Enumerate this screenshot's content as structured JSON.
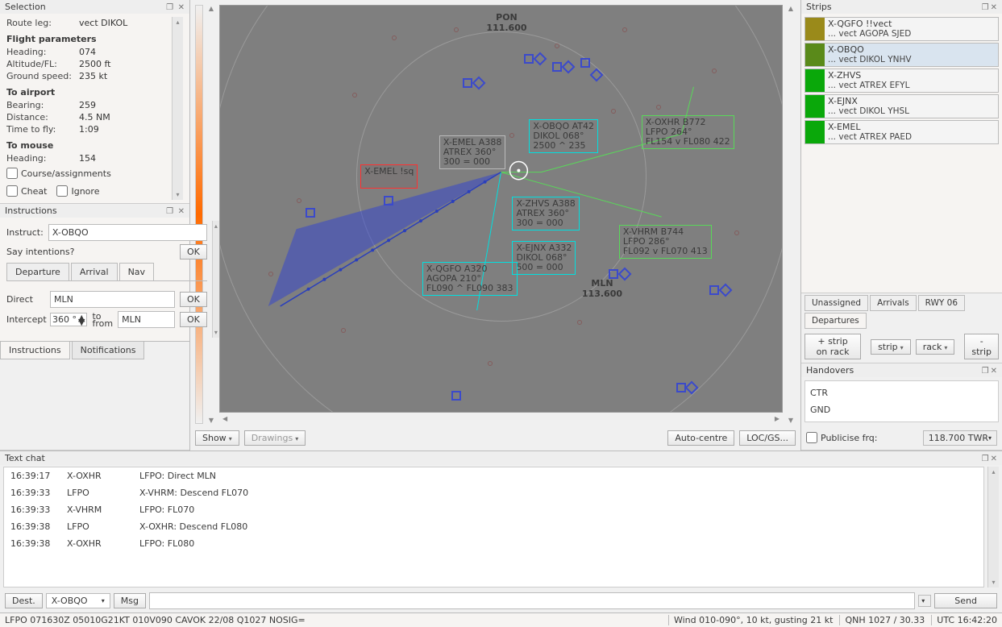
{
  "selection": {
    "title": "Selection",
    "route_leg_label": "Route leg:",
    "route_leg_value": "vect DIKOL",
    "flight_params_title": "Flight parameters",
    "heading_label": "Heading:",
    "heading_value": "074",
    "altitude_label": "Altitude/FL:",
    "altitude_value": "2500 ft",
    "gs_label": "Ground speed:",
    "gs_value": "235 kt",
    "to_airport_title": "To airport",
    "bearing_label": "Bearing:",
    "bearing_value": "259",
    "distance_label": "Distance:",
    "distance_value": "4.5 NM",
    "ttf_label": "Time to fly:",
    "ttf_value": "1:09",
    "to_mouse_title": "To mouse",
    "mheading_label": "Heading:",
    "mheading_value": "154",
    "course_label": "Course/assignments",
    "cheat_label": "Cheat",
    "ignore_label": "Ignore"
  },
  "instructions": {
    "title": "Instructions",
    "instruct_label": "Instruct:",
    "instruct_value": "X-OBQO",
    "say_label": "Say intentions?",
    "ok": "OK",
    "tabs": [
      "Departure",
      "Arrival",
      "Nav"
    ],
    "active_tab": "Nav",
    "direct_label": "Direct",
    "direct_value": "MLN",
    "intercept_label": "Intercept",
    "intercept_deg": "360 °",
    "tofrom_label_to": "to",
    "tofrom_label_from": "from",
    "intercept_value": "MLN",
    "bottom_tabs": [
      "Instructions",
      "Notifications"
    ],
    "active_bottom_tab": "Notifications"
  },
  "radar": {
    "show_btn": "Show",
    "drawings_btn": "Drawings",
    "autocentre_btn": "Auto-centre",
    "locgs_btn": "LOC/GS...",
    "vor_pon": {
      "name": "PON",
      "freq": "111.600"
    },
    "vor_mln": {
      "name": "MLN",
      "freq": "113.600"
    },
    "blocks": {
      "obqo": [
        "X-OBQO   AT42",
        "DIKOL  068°",
        "2500 ^ 235"
      ],
      "emel": [
        "X-EMEL   A388",
        "ATREX  360°",
        "300 =  000"
      ],
      "zhvs": [
        "X-ZHVS   A388",
        "ATREX  360°",
        "300 =  000"
      ],
      "ejnx": [
        "X-EJNX   A332",
        "DIKOL  068°",
        "500 =  000"
      ],
      "qgfo": [
        "X-QGFO   A320",
        "AGOPA  210°",
        "FL090 ^ FL090  383"
      ],
      "oxhr": [
        "X-OXHR   B772",
        "LFPO  264°",
        "FL154 v FL080  422"
      ],
      "vhrm": [
        "X-VHRM   B744",
        "LFPO  286°",
        "FL092 v FL070  413"
      ],
      "red": [
        "X-EMEL  !sq",
        " ",
        " "
      ]
    }
  },
  "strips": {
    "title": "Strips",
    "items": [
      {
        "l1": "X-QGFO  !!vect",
        "l2": "... vect AGOPA  SJED",
        "color": "#9a8a1a"
      },
      {
        "l1": "X-OBQO",
        "l2": "... vect DIKOL  YNHV",
        "color": "#5a8a1a",
        "sel": true
      },
      {
        "l1": "X-ZHVS",
        "l2": "... vect ATREX  EFYL",
        "color": "#0aa80a"
      },
      {
        "l1": "X-EJNX",
        "l2": "... vect DIKOL  YHSL",
        "color": "#0aa80a"
      },
      {
        "l1": "X-EMEL",
        "l2": "... vect ATREX  PAED",
        "color": "#0aa80a"
      }
    ],
    "racks": [
      "Unassigned",
      "Arrivals",
      "RWY 06",
      "Departures"
    ],
    "active_rack": "Departures",
    "btn_addrack": "+ strip on rack",
    "btn_strip": "strip",
    "btn_rack": "rack",
    "btn_removestrip": "- strip"
  },
  "handovers": {
    "title": "Handovers",
    "lines": [
      "CTR",
      "GND"
    ],
    "publicise_label": "Publicise frq:",
    "freq_combo": "118.700  TWR"
  },
  "chat": {
    "title": "Text chat",
    "rows": [
      {
        "t": "16:39:17",
        "s": "X-OXHR",
        "m": "LFPO: Direct MLN"
      },
      {
        "t": "16:39:33",
        "s": "LFPO",
        "m": "X-VHRM: Descend FL070"
      },
      {
        "t": "16:39:33",
        "s": "X-VHRM",
        "m": "LFPO: FL070"
      },
      {
        "t": "16:39:38",
        "s": "LFPO",
        "m": "X-OXHR: Descend FL080"
      },
      {
        "t": "16:39:38",
        "s": "X-OXHR",
        "m": "LFPO: FL080"
      }
    ],
    "dest_btn": "Dest.",
    "dest_value": "X-OBQO",
    "msg_btn": "Msg",
    "send_btn": "Send"
  },
  "status": {
    "metar": "LFPO 071630Z 05010G21KT 010V090 CAVOK 22/08 Q1027 NOSIG=",
    "wind": "Wind 010-090°, 10 kt, gusting 21 kt",
    "qnh": "QNH 1027 / 30.33",
    "utc": "UTC 16:42:20"
  }
}
